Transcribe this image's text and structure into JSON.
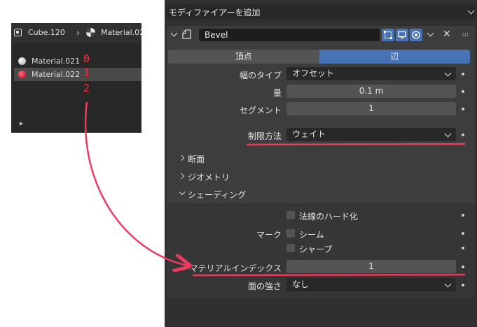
{
  "material_panel": {
    "object_name": "Cube.120",
    "material_name": "Material.02",
    "materials": [
      {
        "name": "Material.021",
        "color": "#cccccc",
        "index_label": "0"
      },
      {
        "name": "Material.022",
        "color": "#e23247",
        "index_label": "1",
        "selected": true
      }
    ],
    "extra_index_label": "2"
  },
  "modifier_panel": {
    "add_modifier": "モディファイアーを追加",
    "modifier_name": "Bevel",
    "tabs": [
      {
        "label": "頂点",
        "active": false
      },
      {
        "label": "辺",
        "active": true
      }
    ],
    "props": {
      "width_type": {
        "label": "幅のタイプ",
        "value": "オフセット"
      },
      "amount": {
        "label": "量",
        "value": "0.1 m"
      },
      "segments": {
        "label": "セグメント",
        "value": "1"
      },
      "limit_method": {
        "label": "制限方法",
        "value": "ウェイト"
      }
    },
    "subpanels": {
      "profile": "断面",
      "geometry": "ジオメトリ",
      "shading": "シェーディング"
    },
    "shading": {
      "harden_normals": "法線のハード化",
      "mark_label": "マーク",
      "mark_seam": "シーム",
      "mark_sharp": "シャープ",
      "material_index": {
        "label": "マテリアルインデックス",
        "value": "1"
      },
      "face_strength": {
        "label": "面の強さ",
        "value": "なし"
      }
    }
  },
  "annotation_color": "#ee3a5f",
  "accent": "#4772b3"
}
